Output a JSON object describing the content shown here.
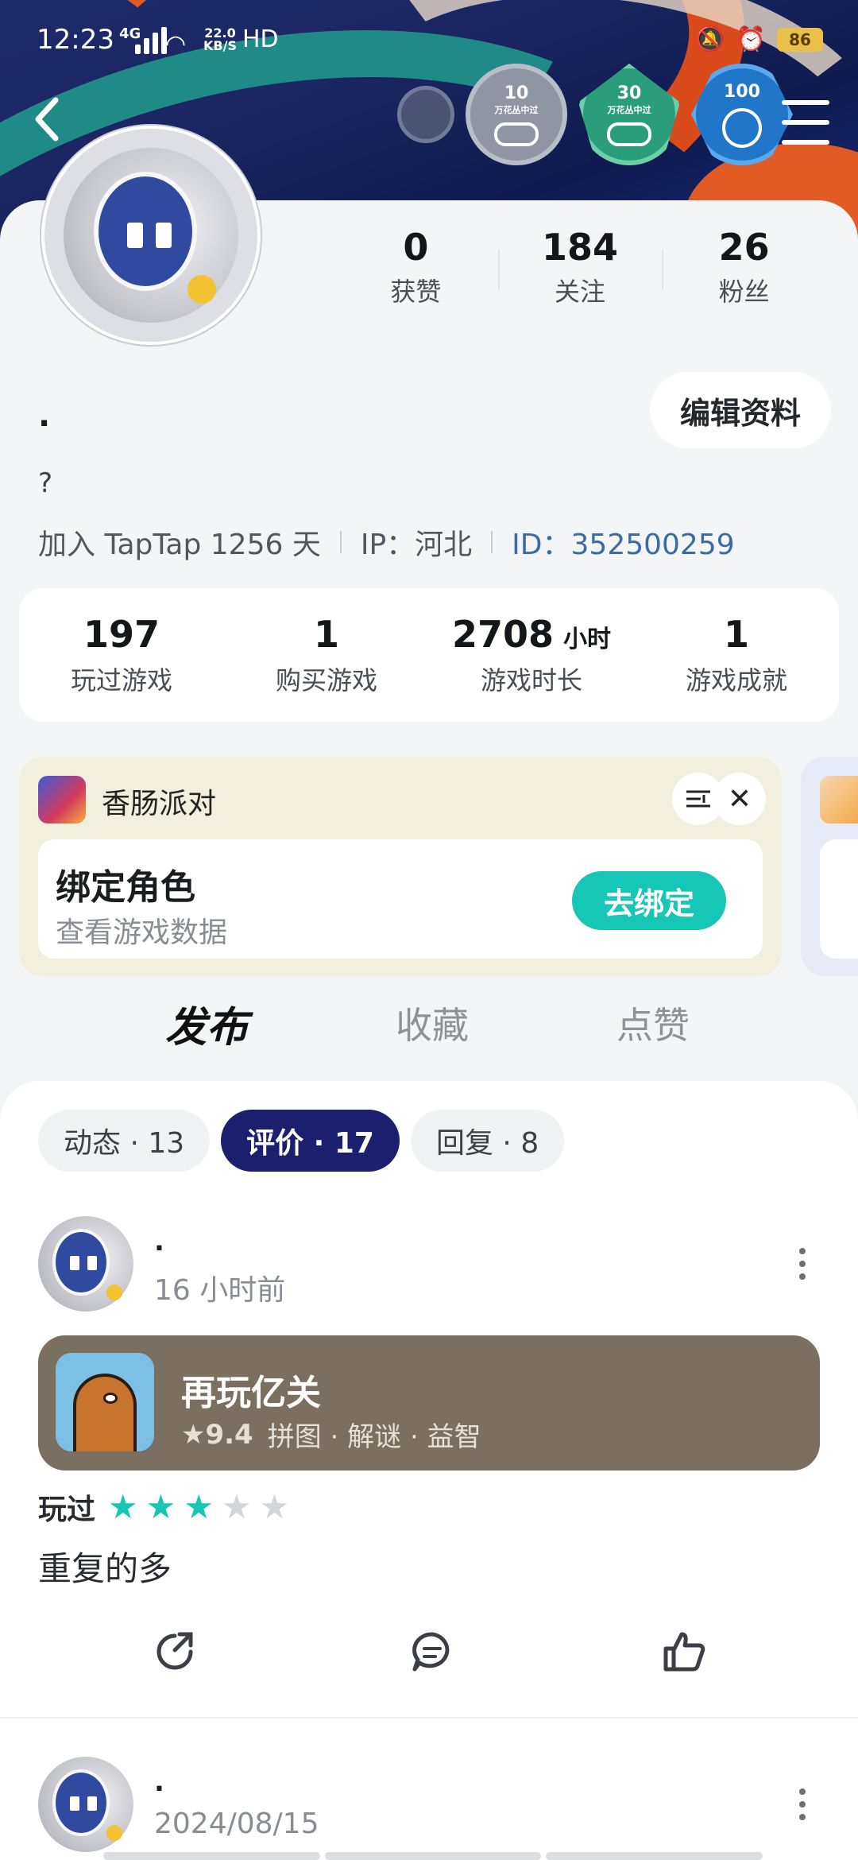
{
  "status_bar": {
    "time": "12:23",
    "network": "4G",
    "speed_top": "22.0",
    "speed_bottom": "KB/S",
    "hd": "HD",
    "battery": "86"
  },
  "badges": {
    "badge_10": {
      "number": "10",
      "caption": "万花丛中过"
    },
    "badge_30": {
      "number": "30",
      "caption": "万花丛中过"
    },
    "badge_100": {
      "number": "100"
    }
  },
  "profile": {
    "counts": [
      {
        "value": "0",
        "label": "获赞"
      },
      {
        "value": "184",
        "label": "关注"
      },
      {
        "value": "26",
        "label": "粉丝"
      }
    ],
    "edit_label": "编辑资料",
    "nickname": ".",
    "bio": "?",
    "joined": "加入 TapTap 1256 天",
    "ip": "IP：河北",
    "id": "ID：352500259"
  },
  "stats": [
    {
      "value": "197",
      "unit": "",
      "label": "玩过游戏"
    },
    {
      "value": "1",
      "unit": "",
      "label": "购买游戏"
    },
    {
      "value": "2708",
      "unit": "小时",
      "label": "游戏时长"
    },
    {
      "value": "1",
      "unit": "",
      "label": "游戏成就"
    }
  ],
  "bind_card": {
    "game_name": "香肠派对",
    "title": "绑定角色",
    "subtitle": "查看游戏数据",
    "button": "去绑定"
  },
  "main_tabs": [
    "发布",
    "收藏",
    "点赞"
  ],
  "filter_chips": [
    "动态 · 13",
    "评价 · 17",
    "回复 · 8"
  ],
  "posts": [
    {
      "author": ".",
      "time": "16 小时前",
      "game": {
        "name": "再玩亿关",
        "score": "9.4",
        "tags": "拼图 · 解谜 · 益智"
      },
      "played_label": "玩过",
      "rating": 3,
      "rating_max": 5,
      "text": "重复的多"
    },
    {
      "author": ".",
      "time": "2024/08/15"
    }
  ],
  "colors": {
    "accent": "#16c6b6",
    "chip_active": "#1b1f6e",
    "id_link": "#3c6aa1",
    "game_box": "#7a6f60"
  }
}
